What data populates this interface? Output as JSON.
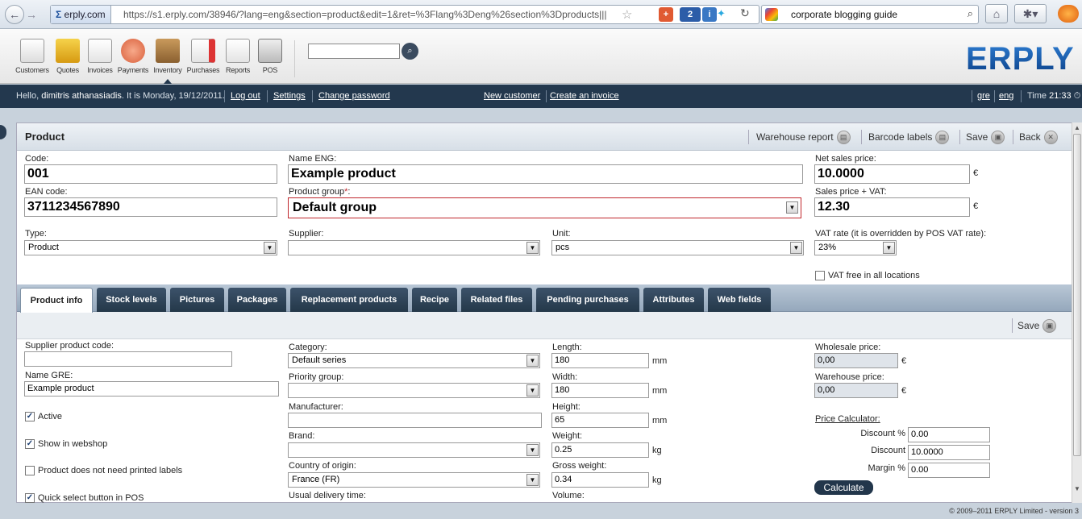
{
  "browser": {
    "site_badge": "erply.com",
    "url": "https://s1.erply.com/38946/?lang=eng&section=product&edit=1&ret=%3Flang%3Deng%26section%3Dproducts|||",
    "search_text": "corporate blogging guide",
    "badge_count": "2"
  },
  "modules": [
    {
      "label": "Customers"
    },
    {
      "label": "Quotes"
    },
    {
      "label": "Invoices"
    },
    {
      "label": "Payments"
    },
    {
      "label": "Inventory"
    },
    {
      "label": "Purchases"
    },
    {
      "label": "Reports"
    },
    {
      "label": "POS"
    }
  ],
  "logo": "ERPLY",
  "topbar": {
    "hello": "Hello,",
    "user": "dimitris athanasiadis",
    "date_text": ". It is Monday, 19/12/2011.",
    "logout": "Log out",
    "settings": "Settings",
    "change_password": "Change password",
    "new_customer": "New customer",
    "create_invoice": "Create an invoice",
    "lang_gre": "gre",
    "lang_eng": "eng",
    "time_label": "Time",
    "time": "21:33"
  },
  "product": {
    "title": "Product",
    "warehouse_report": "Warehouse report",
    "barcode_labels": "Barcode labels",
    "save": "Save",
    "back": "Back",
    "code_label": "Code:",
    "code": "001",
    "name_label": "Name ENG:",
    "name": "Example product",
    "net_label": "Net sales price:",
    "net": "10.0000",
    "ean_label": "EAN code:",
    "ean": "3711234567890",
    "group_label": "Product group",
    "group_required": "*",
    "group_colon": ":",
    "group": "Default group",
    "vat_price_label": "Sales price + VAT:",
    "vat_price": "12.30",
    "currency": "€",
    "type_label": "Type:",
    "type": "Product",
    "supplier_label": "Supplier:",
    "supplier": "",
    "unit_label": "Unit:",
    "unit": "pcs",
    "vat_rate_label": "VAT rate (it is overridden by POS VAT rate):",
    "vat_rate": "23%",
    "vat_free_label": "VAT free in all locations"
  },
  "tabs": [
    {
      "label": "Product info"
    },
    {
      "label": "Stock levels"
    },
    {
      "label": "Pictures"
    },
    {
      "label": "Packages"
    },
    {
      "label": "Replacement products"
    },
    {
      "label": "Recipe"
    },
    {
      "label": "Related files"
    },
    {
      "label": "Pending purchases"
    },
    {
      "label": "Attributes"
    },
    {
      "label": "Web fields"
    }
  ],
  "info": {
    "save": "Save",
    "supplier_code_label": "Supplier product code:",
    "supplier_code": "",
    "name_gre_label": "Name GRE:",
    "name_gre": "Example product",
    "active_label": "Active",
    "webshop_label": "Show in webshop",
    "no_labels_label": "Product does not need printed labels",
    "quick_select_label": "Quick select button in POS",
    "category_label": "Category:",
    "category": "Default series",
    "priority_label": "Priority group:",
    "priority": "",
    "manufacturer_label": "Manufacturer:",
    "manufacturer": "",
    "brand_label": "Brand:",
    "brand": "",
    "country_label": "Country of origin:",
    "country": "France (FR)",
    "delivery_label": "Usual delivery time:",
    "length_label": "Length:",
    "length": "180",
    "width_label": "Width:",
    "width": "180",
    "height_label": "Height:",
    "height": "65",
    "mm": "mm",
    "weight_label": "Weight:",
    "weight": "0.25",
    "gross_label": "Gross weight:",
    "gross": "0.34",
    "kg": "kg",
    "volume_label": "Volume:",
    "wholesale_label": "Wholesale price:",
    "wholesale": "0,00",
    "warehouse_label": "Warehouse price:",
    "warehouse": "0,00",
    "calc_label": "Price Calculator:",
    "discount_pct_label": "Discount %",
    "discount_pct": "0.00",
    "discount_label": "Discount",
    "discount": "10.0000",
    "margin_label": "Margin %",
    "margin": "0.00",
    "calculate": "Calculate"
  },
  "footer": "© 2009–2011 ERPLY Limited - version 3",
  "colors": {
    "accent": "#23384e",
    "tab": "#2d4258",
    "required_border": "#c0272d"
  }
}
